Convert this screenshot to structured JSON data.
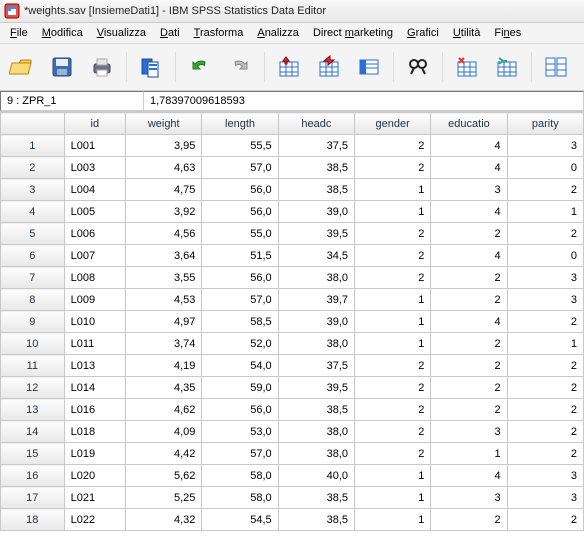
{
  "title": "*weights.sav [InsiemeDati1] - IBM SPSS Statistics Data Editor",
  "menu": {
    "file": "File",
    "modifica": "Modifica",
    "visualizza": "Visualizza",
    "dati": "Dati",
    "trasforma": "Trasforma",
    "analizza": "Analizza",
    "direct": "Direct marketing",
    "grafici": "Grafici",
    "utilita": "Utilità",
    "fines": "Fines"
  },
  "infobar": {
    "cell_name": "9 : ZPR_1",
    "cell_value": "1,78397009618593"
  },
  "columns": [
    "id",
    "weight",
    "length",
    "headc",
    "gender",
    "educatio",
    "parity"
  ],
  "rows": [
    {
      "n": "1",
      "id": "L001",
      "weight": "3,95",
      "length": "55,5",
      "headc": "37,5",
      "gender": "2",
      "educatio": "4",
      "parity": "3"
    },
    {
      "n": "2",
      "id": "L003",
      "weight": "4,63",
      "length": "57,0",
      "headc": "38,5",
      "gender": "2",
      "educatio": "4",
      "parity": "0"
    },
    {
      "n": "3",
      "id": "L004",
      "weight": "4,75",
      "length": "56,0",
      "headc": "38,5",
      "gender": "1",
      "educatio": "3",
      "parity": "2"
    },
    {
      "n": "4",
      "id": "L005",
      "weight": "3,92",
      "length": "56,0",
      "headc": "39,0",
      "gender": "1",
      "educatio": "4",
      "parity": "1"
    },
    {
      "n": "5",
      "id": "L006",
      "weight": "4,56",
      "length": "55,0",
      "headc": "39,5",
      "gender": "2",
      "educatio": "2",
      "parity": "2"
    },
    {
      "n": "6",
      "id": "L007",
      "weight": "3,64",
      "length": "51,5",
      "headc": "34,5",
      "gender": "2",
      "educatio": "4",
      "parity": "0"
    },
    {
      "n": "7",
      "id": "L008",
      "weight": "3,55",
      "length": "56,0",
      "headc": "38,0",
      "gender": "2",
      "educatio": "2",
      "parity": "3"
    },
    {
      "n": "8",
      "id": "L009",
      "weight": "4,53",
      "length": "57,0",
      "headc": "39,7",
      "gender": "1",
      "educatio": "2",
      "parity": "3"
    },
    {
      "n": "9",
      "id": "L010",
      "weight": "4,97",
      "length": "58,5",
      "headc": "39,0",
      "gender": "1",
      "educatio": "4",
      "parity": "2"
    },
    {
      "n": "10",
      "id": "L011",
      "weight": "3,74",
      "length": "52,0",
      "headc": "38,0",
      "gender": "1",
      "educatio": "2",
      "parity": "1"
    },
    {
      "n": "11",
      "id": "L013",
      "weight": "4,19",
      "length": "54,0",
      "headc": "37,5",
      "gender": "2",
      "educatio": "2",
      "parity": "2"
    },
    {
      "n": "12",
      "id": "L014",
      "weight": "4,35",
      "length": "59,0",
      "headc": "39,5",
      "gender": "2",
      "educatio": "2",
      "parity": "2"
    },
    {
      "n": "13",
      "id": "L016",
      "weight": "4,62",
      "length": "56,0",
      "headc": "38,5",
      "gender": "2",
      "educatio": "2",
      "parity": "2"
    },
    {
      "n": "14",
      "id": "L018",
      "weight": "4,09",
      "length": "53,0",
      "headc": "38,0",
      "gender": "2",
      "educatio": "3",
      "parity": "2"
    },
    {
      "n": "15",
      "id": "L019",
      "weight": "4,42",
      "length": "57,0",
      "headc": "38,0",
      "gender": "2",
      "educatio": "1",
      "parity": "2"
    },
    {
      "n": "16",
      "id": "L020",
      "weight": "5,62",
      "length": "58,0",
      "headc": "40,0",
      "gender": "1",
      "educatio": "4",
      "parity": "3"
    },
    {
      "n": "17",
      "id": "L021",
      "weight": "5,25",
      "length": "58,0",
      "headc": "38,5",
      "gender": "1",
      "educatio": "3",
      "parity": "3"
    },
    {
      "n": "18",
      "id": "L022",
      "weight": "4,32",
      "length": "54,5",
      "headc": "38,5",
      "gender": "1",
      "educatio": "2",
      "parity": "2"
    }
  ]
}
